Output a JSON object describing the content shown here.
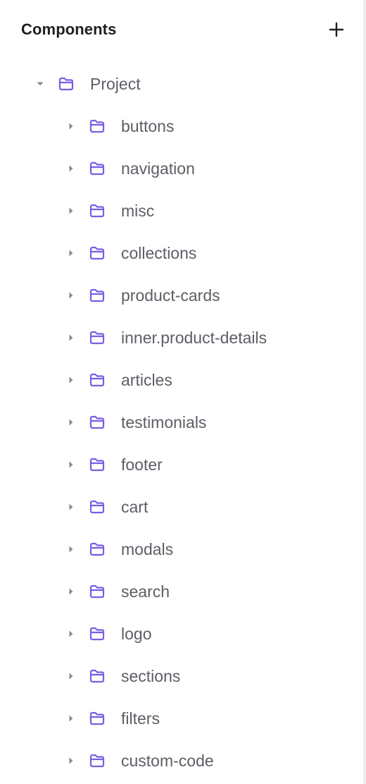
{
  "panel": {
    "title": "Components",
    "add_icon": "plus-icon"
  },
  "colors": {
    "folder": "#7B5CE6",
    "caret": "#8a8a92",
    "label": "#5d5d66",
    "title": "#1f1f23"
  },
  "tree": {
    "root": {
      "label": "Project",
      "expanded": true,
      "icon": "folder-icon"
    },
    "children": [
      {
        "label": "buttons"
      },
      {
        "label": "navigation"
      },
      {
        "label": "misc"
      },
      {
        "label": "collections"
      },
      {
        "label": "product-cards"
      },
      {
        "label": "inner.product-details"
      },
      {
        "label": "articles"
      },
      {
        "label": "testimonials"
      },
      {
        "label": "footer"
      },
      {
        "label": "cart"
      },
      {
        "label": "modals"
      },
      {
        "label": "search"
      },
      {
        "label": "logo"
      },
      {
        "label": "sections"
      },
      {
        "label": "filters"
      },
      {
        "label": "custom-code"
      }
    ]
  }
}
